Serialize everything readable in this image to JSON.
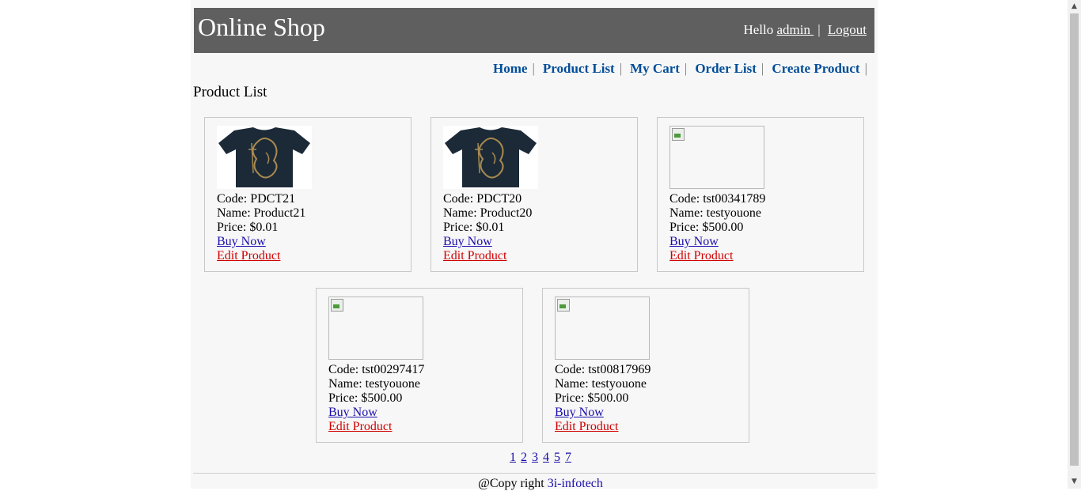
{
  "header": {
    "brand": "Online Shop",
    "greeting": "Hello",
    "user_link": "admin ",
    "separator": "|",
    "logout": "Logout"
  },
  "menu": {
    "items": [
      {
        "label": "Home"
      },
      {
        "label": "Product List"
      },
      {
        "label": "My Cart"
      },
      {
        "label": "Order List"
      },
      {
        "label": "Create Product"
      }
    ],
    "separator": "|"
  },
  "page_title": "Product List",
  "products": [
    {
      "code": "Code: PDCT21",
      "name": "Name: Product21",
      "price": "Price: $0.01",
      "buy": "Buy Now",
      "edit": "Edit Product",
      "image": "tshirt"
    },
    {
      "code": "Code: PDCT20",
      "name": "Name: Product20",
      "price": "Price: $0.01",
      "buy": "Buy Now",
      "edit": "Edit Product",
      "image": "tshirt"
    },
    {
      "code": "Code: tst00341789",
      "name": "Name: testyouone",
      "price": "Price: $500.00",
      "buy": "Buy Now",
      "edit": "Edit Product",
      "image": "broken-image"
    },
    {
      "code": "Code: tst00297417",
      "name": "Name: testyouone",
      "price": "Price: $500.00",
      "buy": "Buy Now",
      "edit": "Edit Product",
      "image": "broken-image"
    },
    {
      "code": "Code: tst00817969",
      "name": "Name: testyouone",
      "price": "Price: $500.00",
      "buy": "Buy Now",
      "edit": "Edit Product",
      "image": "broken-image"
    }
  ],
  "pagination": [
    "1",
    "2",
    "3",
    "4",
    "5",
    "7"
  ],
  "footer": {
    "text": "@Copy right",
    "link": "3i-infotech"
  },
  "colors": {
    "header_bg": "#5f5f5f",
    "menu_link": "#004d99",
    "buy_link": "#1a0dab",
    "edit_link": "#d00000"
  }
}
